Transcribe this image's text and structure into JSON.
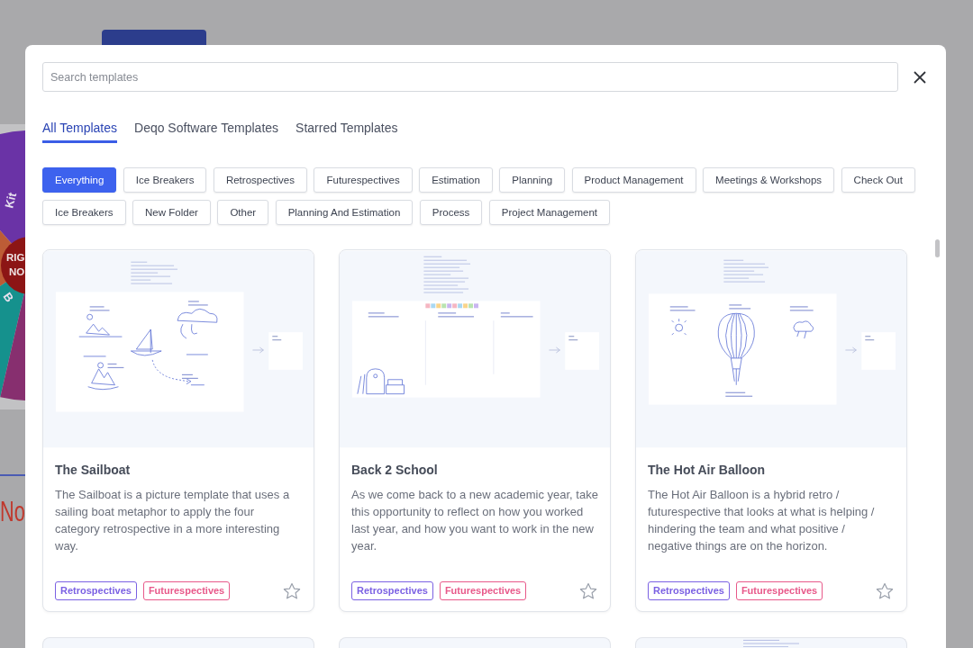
{
  "background": {
    "wheel_labels": [
      "Kit",
      "B"
    ],
    "wheel_hub": [
      "RIG",
      "NO"
    ],
    "heading": "No"
  },
  "dialog": {
    "search": {
      "placeholder": "Search templates"
    },
    "tabs": [
      {
        "label": "All Templates",
        "selected": true
      },
      {
        "label": "Deqo Software Templates",
        "selected": false
      },
      {
        "label": "Starred Templates",
        "selected": false
      }
    ],
    "filters": [
      {
        "label": "Everything",
        "selected": true
      },
      {
        "label": "Ice Breakers",
        "selected": false
      },
      {
        "label": "Retrospectives",
        "selected": false
      },
      {
        "label": "Futurespectives",
        "selected": false
      },
      {
        "label": "Estimation",
        "selected": false
      },
      {
        "label": "Planning",
        "selected": false
      },
      {
        "label": "Product Management",
        "selected": false
      },
      {
        "label": "Meetings & Workshops",
        "selected": false
      },
      {
        "label": "Check Out",
        "selected": false
      },
      {
        "label": "Ice Breakers",
        "selected": false
      },
      {
        "label": "New Folder",
        "selected": false
      },
      {
        "label": "Other",
        "selected": false
      },
      {
        "label": "Planning And Estimation",
        "selected": false
      },
      {
        "label": "Process",
        "selected": false
      },
      {
        "label": "Project Management",
        "selected": false
      }
    ],
    "cards": [
      {
        "kind": "sailboat",
        "title": "The Sailboat",
        "description": "The Sailboat is a picture template that uses a\nsailing boat metaphor to apply the four\ncategory retrospective in a more interesting\nway.",
        "tags": [
          {
            "label": "Retrospectives",
            "color": "#7b61e3"
          },
          {
            "label": "Futurespectives",
            "color": "#e8598a"
          }
        ],
        "starred": false
      },
      {
        "kind": "school",
        "title": "Back 2 School",
        "description": "As we come back to a new academic year, take\nthis opportunity to reflect on how you worked\nlast year, and how you want to work in the new\nyear.",
        "tags": [
          {
            "label": "Retrospectives",
            "color": "#7b61e3"
          },
          {
            "label": "Futurespectives",
            "color": "#e8598a"
          }
        ],
        "starred": false
      },
      {
        "kind": "balloon",
        "title": "The Hot Air Balloon",
        "description": "The Hot Air Balloon is a hybrid retro /\nfuturespective that looks at what is helping /\nhindering the team and what positive /\nnegative things are on the horizon.",
        "tags": [
          {
            "label": "Retrospectives",
            "color": "#7b61e3"
          },
          {
            "label": "Futurespectives",
            "color": "#e8598a"
          }
        ],
        "starred": false
      },
      {
        "kind": "blank"
      },
      {
        "kind": "blank"
      },
      {
        "kind": "document"
      }
    ]
  }
}
